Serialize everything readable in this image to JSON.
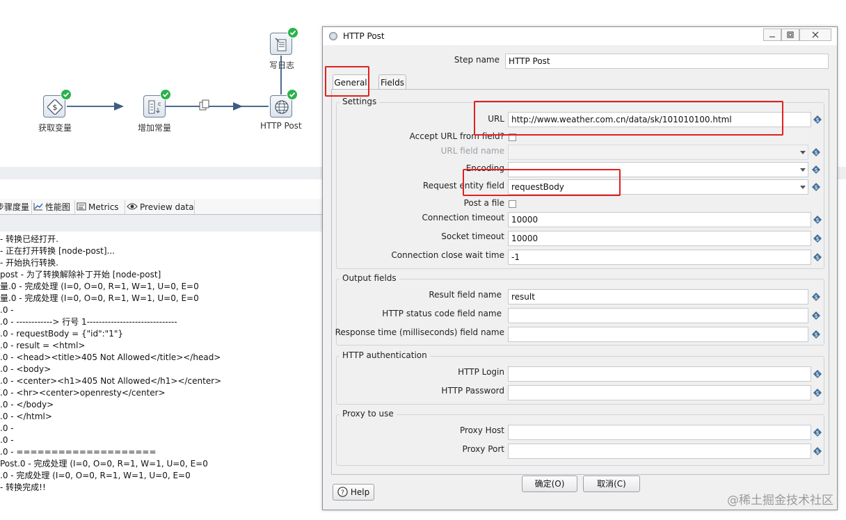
{
  "canvas": {
    "steps": [
      {
        "name": "获取变量",
        "icon": "get-variable-icon"
      },
      {
        "name": "增加常量",
        "icon": "add-constant-icon"
      },
      {
        "name": "HTTP Post",
        "icon": "globe-icon"
      },
      {
        "name": "写日志",
        "icon": "write-log-icon"
      }
    ]
  },
  "log_tabs": [
    {
      "label": "步骤度量",
      "icon": "step-metrics-icon"
    },
    {
      "label": "性能图",
      "icon": "performance-chart-icon"
    },
    {
      "label": "Metrics",
      "icon": "metrics-icon"
    },
    {
      "label": "Preview data",
      "icon": "eye-icon"
    }
  ],
  "log_lines": [
    " - 转换已经打开.",
    " - 正在打开转换 [node-post]...",
    " - 开始执行转换.",
    "post - 为了转换解除补丁开始  [node-post]",
    "量.0 - 完成处理 (I=0, O=0, R=1, W=1, U=0, E=0",
    "量.0 - 完成处理 (I=0, O=0, R=1, W=1, U=0, E=0",
    ".0 -",
    ".0 - ------------> 行号 1------------------------------",
    ".0 - requestBody = {\"id\":\"1\"}",
    ".0 - result = <html>",
    ".0 - <head><title>405 Not Allowed</title></head>",
    ".0 - <body>",
    ".0 - <center><h1>405 Not Allowed</h1></center>",
    ".0 - <hr><center>openresty</center>",
    ".0 - </body>",
    ".0 - </html>",
    ".0 -",
    ".0 -",
    ".0 - ====================",
    "Post.0 - 完成处理 (I=0, O=0, R=1, W=1, U=0, E=0",
    ".0 - 完成处理 (I=0, O=0, R=1, W=1, U=0, E=0",
    " - 转换完成!!"
  ],
  "dialog": {
    "title": "HTTP Post",
    "step_name_label": "Step name",
    "step_name_value": "HTTP Post",
    "tabs": [
      "General",
      "Fields"
    ],
    "settings": {
      "title": "Settings",
      "url_label": "URL",
      "url_value": "http://www.weather.com.cn/data/sk/101010100.html",
      "accept_url_label": "Accept URL from field?",
      "url_field_name_label": "URL field name",
      "encoding_label": "Encoding",
      "request_entity_label": "Request entity field",
      "request_entity_value": "requestBody",
      "post_file_label": "Post a file",
      "connection_timeout_label": "Connection timeout",
      "connection_timeout_value": "10000",
      "socket_timeout_label": "Socket timeout",
      "socket_timeout_value": "10000",
      "close_wait_label": "Connection close wait time",
      "close_wait_value": "-1"
    },
    "output": {
      "title": "Output fields",
      "result_label": "Result field name",
      "result_value": "result",
      "status_label": "HTTP status code field name",
      "response_time_label": "Response time (milliseconds) field name"
    },
    "auth": {
      "title": "HTTP authentication",
      "login_label": "HTTP Login",
      "password_label": "HTTP Password"
    },
    "proxy": {
      "title": "Proxy to use",
      "host_label": "Proxy Host",
      "port_label": "Proxy Port"
    },
    "buttons": {
      "help": "Help",
      "ok": "确定(O)",
      "cancel": "取消(C)"
    }
  },
  "watermark": "@稀土掘金技术社区",
  "colors": {
    "highlight": "#e0201f",
    "success": "#2bb24c",
    "hop": "#4a6a8e"
  }
}
